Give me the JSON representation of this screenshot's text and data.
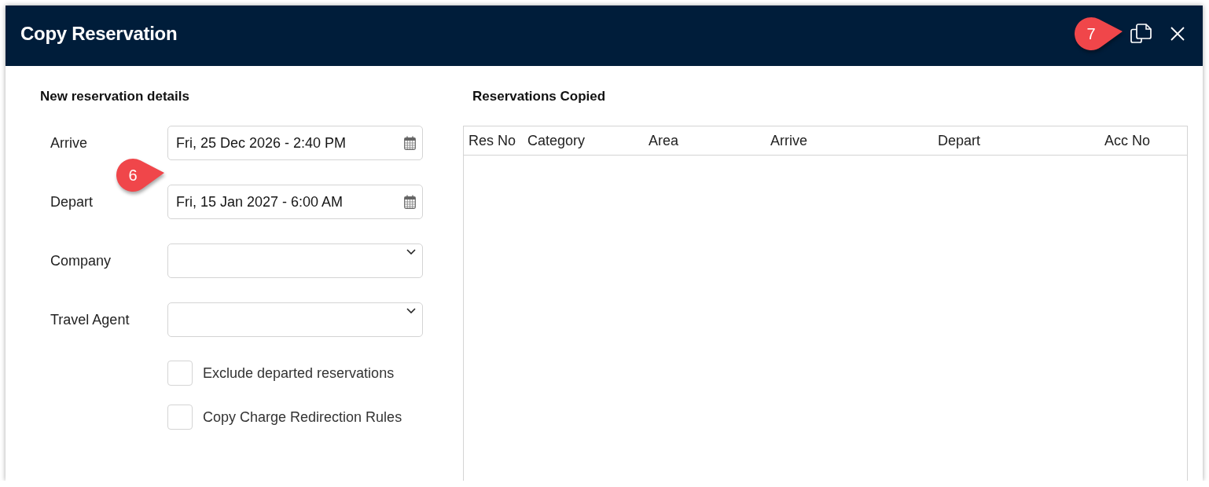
{
  "dialog": {
    "title": "Copy Reservation",
    "callout": "7"
  },
  "details": {
    "heading": "New reservation details",
    "callout": "6",
    "fields": [
      {
        "kind": "date",
        "label": "Arrive",
        "value": "Fri, 25 Dec 2026 - 2:40 PM"
      },
      {
        "kind": "date",
        "label": "Depart",
        "value": "Fri, 15 Jan 2027 - 6:00 AM"
      },
      {
        "kind": "select",
        "label": "Company"
      },
      {
        "kind": "select",
        "label": "Travel Agent"
      }
    ],
    "options": [
      {
        "label": "Exclude departed reservations",
        "checked": false
      },
      {
        "label": "Copy Charge Redirection Rules",
        "checked": false
      }
    ]
  },
  "copied": {
    "heading": "Reservations Copied",
    "columns": [
      "Res No",
      "Category",
      "Area",
      "Arrive",
      "Depart",
      "Acc No"
    ]
  }
}
